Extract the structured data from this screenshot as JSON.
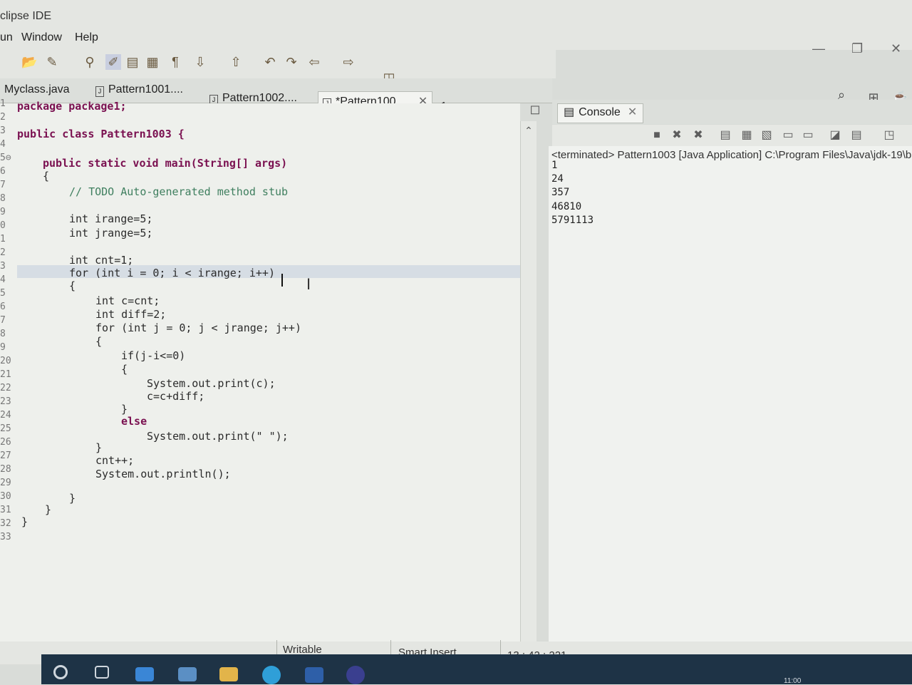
{
  "window": {
    "title": "clipse IDE"
  },
  "menu": [
    "un",
    "Window",
    "Help"
  ],
  "window_controls": {
    "minimize": "—",
    "restore": "❐",
    "close": "✕"
  },
  "toolbar_icons": [
    "open-icon",
    "run-icon",
    "debug-icon",
    "edit-icon",
    "save-icon",
    "format-icon",
    "pilcrow-icon",
    "next-annotation-icon",
    "previous-annotation-icon",
    "back-icon",
    "forward-icon",
    "nav-back-icon",
    "nav-forward-icon",
    "new-window-icon"
  ],
  "tabs": [
    {
      "label": "Myclass.java",
      "active": false
    },
    {
      "label": "Pattern1001....",
      "active": false
    },
    {
      "label": "Pattern1002....",
      "active": false
    },
    {
      "label": "*Pattern100...",
      "active": true
    }
  ],
  "tab_overflow": "»1",
  "editor": {
    "line_numbers": [
      "1",
      "2",
      "3",
      "4",
      "5⊖",
      "6",
      "7",
      "8",
      "9",
      "0",
      "1",
      "2",
      "3",
      "4",
      "5",
      "6",
      "7",
      "8",
      "9",
      "20",
      "21",
      "22",
      "23",
      "24",
      "25",
      "26",
      "27",
      "28",
      "29",
      "30",
      "31",
      "32",
      "33"
    ],
    "lines": [
      "package package1;",
      "public class Pattern1003 {",
      "public static void main(String[] args)",
      "{",
      "// TODO Auto-generated method stub",
      "int irange=5;",
      "int jrange=5;",
      "int cnt=1;",
      "for (int i = 0; i < irange; i++)",
      "{",
      "int c=cnt;",
      "int diff=2;",
      "for (int j = 0; j < jrange; j++)",
      "{",
      "if(j-i<=0)",
      "{",
      "System.out.print(c);",
      "c=c+diff;",
      "}",
      "else",
      "System.out.print(\" \");",
      "}",
      "cnt++;",
      "System.out.println();",
      "}",
      "}",
      "}"
    ]
  },
  "console": {
    "tab_label": "Console",
    "status": "<terminated> Pattern1003 [Java Application] C:\\Program Files\\Java\\jdk-19\\b",
    "output": [
      "1",
      "24",
      "357",
      "46810",
      "5791113"
    ]
  },
  "statusbar": {
    "writable": "Writable",
    "insert_mode": "Smart Insert",
    "position": "13 : 42 : 221"
  },
  "taskbar": {
    "icons": [
      "search-icon",
      "task-view-icon",
      "mail-icon",
      "store-icon",
      "file-explorer-icon",
      "edge-icon",
      "word-icon",
      "eclipse-icon"
    ],
    "clock": "11:00"
  }
}
